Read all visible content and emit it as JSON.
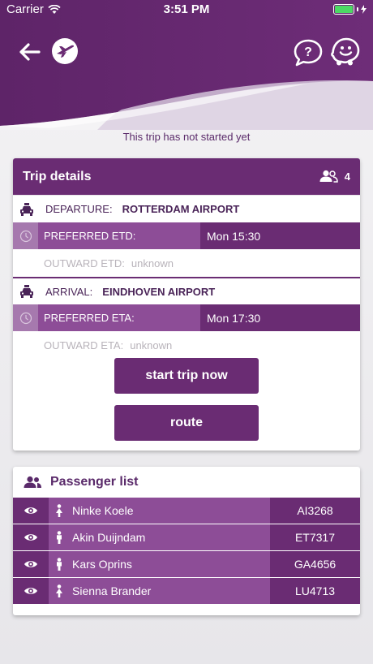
{
  "status_bar": {
    "carrier": "Carrier",
    "time": "3:51 PM",
    "battery_level": 1.0
  },
  "header": {
    "back_icon": "arrow-left-icon",
    "logo_icon": "plane-logo-icon",
    "help_icon": "question-bubble-icon",
    "waze_icon": "waze-icon"
  },
  "trip_status": "This trip has not started yet",
  "trip_details": {
    "title": "Trip details",
    "passenger_count": "4",
    "departure": {
      "label": "DEPARTURE:",
      "location": "ROTTERDAM AIRPORT",
      "preferred_label": "PREFERRED ETD:",
      "preferred_value": "Mon 15:30",
      "estimate_label": "OUTWARD ETD:",
      "estimate_value": "unknown"
    },
    "arrival": {
      "label": "ARRIVAL:",
      "location": "EINDHOVEN AIRPORT",
      "preferred_label": "PREFERRED ETA:",
      "preferred_value": "Mon 17:30",
      "estimate_label": "OUTWARD ETA:",
      "estimate_value": "unknown"
    },
    "start_button": "start trip now",
    "route_button": "route"
  },
  "passenger_list": {
    "title": "Passenger list",
    "passengers": [
      {
        "name": "Ninke Koele",
        "code": "AI3268",
        "gender": "female"
      },
      {
        "name": "Akin Duijndam",
        "code": "ET7317",
        "gender": "male"
      },
      {
        "name": "Kars Oprins",
        "code": "GA4656",
        "gender": "male"
      },
      {
        "name": "Sienna Brander",
        "code": "LU4713",
        "gender": "female"
      }
    ]
  },
  "colors": {
    "primary": "#6a2c73",
    "secondary": "#8d4d97",
    "light": "#a679ae"
  }
}
